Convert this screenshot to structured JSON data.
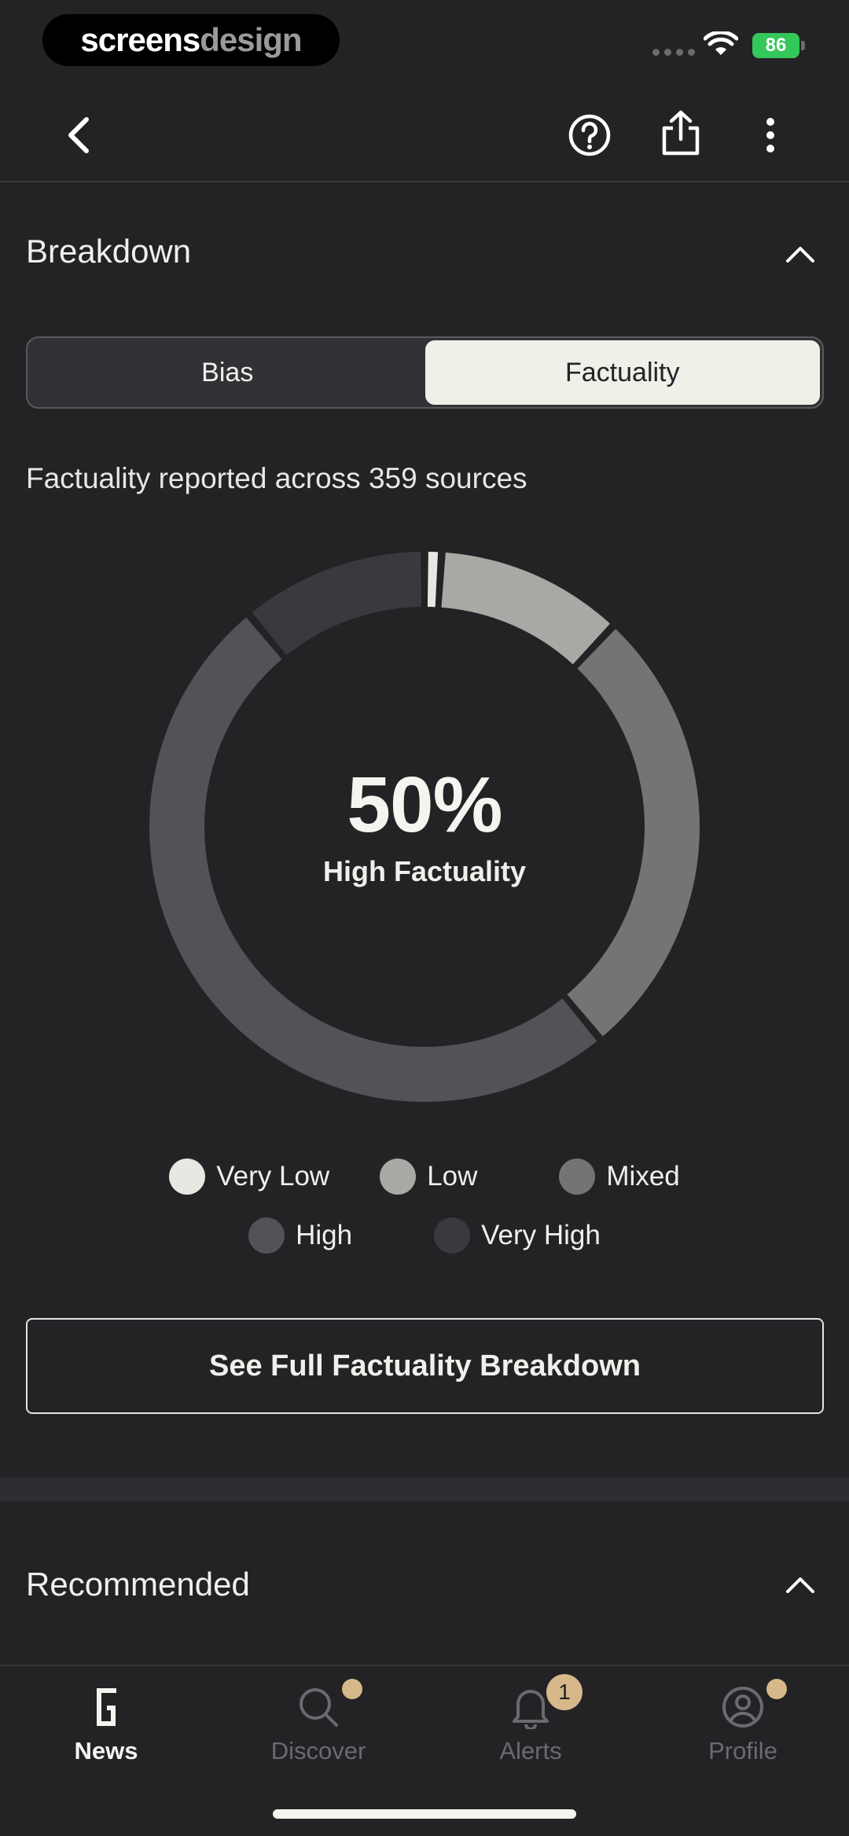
{
  "status_bar": {
    "brand_part1": "screens",
    "brand_part2": "design",
    "battery": "86"
  },
  "header": {
    "back_icon": "chevron-left-icon",
    "help_icon": "question-circle-icon",
    "share_icon": "share-icon",
    "more_icon": "more-vertical-icon"
  },
  "breakdown": {
    "title": "Breakdown",
    "tabs": [
      {
        "label": "Bias",
        "active": false
      },
      {
        "label": "Factuality",
        "active": true
      }
    ],
    "caption": "Factuality reported across 359 sources",
    "center_value": "50%",
    "center_label": "High Factuality",
    "legend": [
      {
        "label": "Very Low",
        "color": "#e8e7e2"
      },
      {
        "label": "Low",
        "color": "#a9a8a5"
      },
      {
        "label": "Mixed",
        "color": "#757472"
      },
      {
        "label": "High",
        "color": "#535256"
      },
      {
        "label": "Very High",
        "color": "#3a393d"
      }
    ],
    "full_button": "See Full Factuality Breakdown"
  },
  "chart_data": {
    "type": "pie",
    "categories": [
      "Very Low",
      "Low",
      "Mixed",
      "High",
      "Very High"
    ],
    "values": [
      1,
      11,
      27,
      50,
      11
    ],
    "colors": [
      "#e8e7e2",
      "#a9a8a5",
      "#757472",
      "#535256",
      "#3a393d"
    ]
  },
  "recommended": {
    "title": "Recommended"
  },
  "bottom_nav": {
    "items": [
      {
        "label": "News",
        "icon": "ground-news-logo-icon",
        "active": true
      },
      {
        "label": "Discover",
        "icon": "search-icon",
        "active": false
      },
      {
        "label": "Alerts",
        "icon": "bell-icon",
        "active": false,
        "badge": "1"
      },
      {
        "label": "Profile",
        "icon": "user-circle-icon",
        "active": false
      }
    ]
  }
}
